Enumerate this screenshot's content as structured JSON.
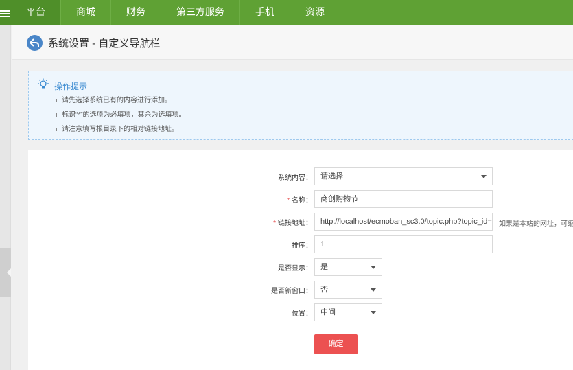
{
  "nav": {
    "tabs": [
      {
        "label": "平台"
      },
      {
        "label": "商城"
      },
      {
        "label": "财务"
      },
      {
        "label": "第三方服务"
      },
      {
        "label": "手机"
      },
      {
        "label": "资源"
      }
    ]
  },
  "header": {
    "title": "系统设置 - 自定义导航栏"
  },
  "tips": {
    "title": "操作提示",
    "items": [
      "请先选择系统已有的内容进行添加。",
      "标识“*”的选项为必填项，其余为选填项。",
      "请注意填写根目录下的相对链接地址。"
    ]
  },
  "form": {
    "system_content": {
      "label": "系统内容：",
      "value": "请选择"
    },
    "name": {
      "required": "*",
      "label": "名称：",
      "value": "商创购物节"
    },
    "link": {
      "required": "*",
      "label": "链接地址：",
      "value": "http://localhost/ecmoban_sc3.0/topic.php?topic_id=",
      "hint": "如果是本站的网址，可缩"
    },
    "order": {
      "label": "排序：",
      "value": "1"
    },
    "show": {
      "label": "是否显示：",
      "value": "是"
    },
    "new_window": {
      "label": "是否新窗口：",
      "value": "否"
    },
    "position": {
      "label": "位置：",
      "value": "中间"
    },
    "submit_label": "确定"
  },
  "colors": {
    "nav_bg": "#5fa134",
    "nav_active": "#4f8f29",
    "tips_bg": "#eef6fd",
    "tips_title": "#3b8bd1",
    "submit_bg": "#ec5151",
    "back_btn": "#4a86c8"
  },
  "icons": [
    "menu-icon",
    "back-arrow-icon",
    "lightbulb-icon",
    "chevron-down-icon",
    "collapse-left-icon"
  ]
}
